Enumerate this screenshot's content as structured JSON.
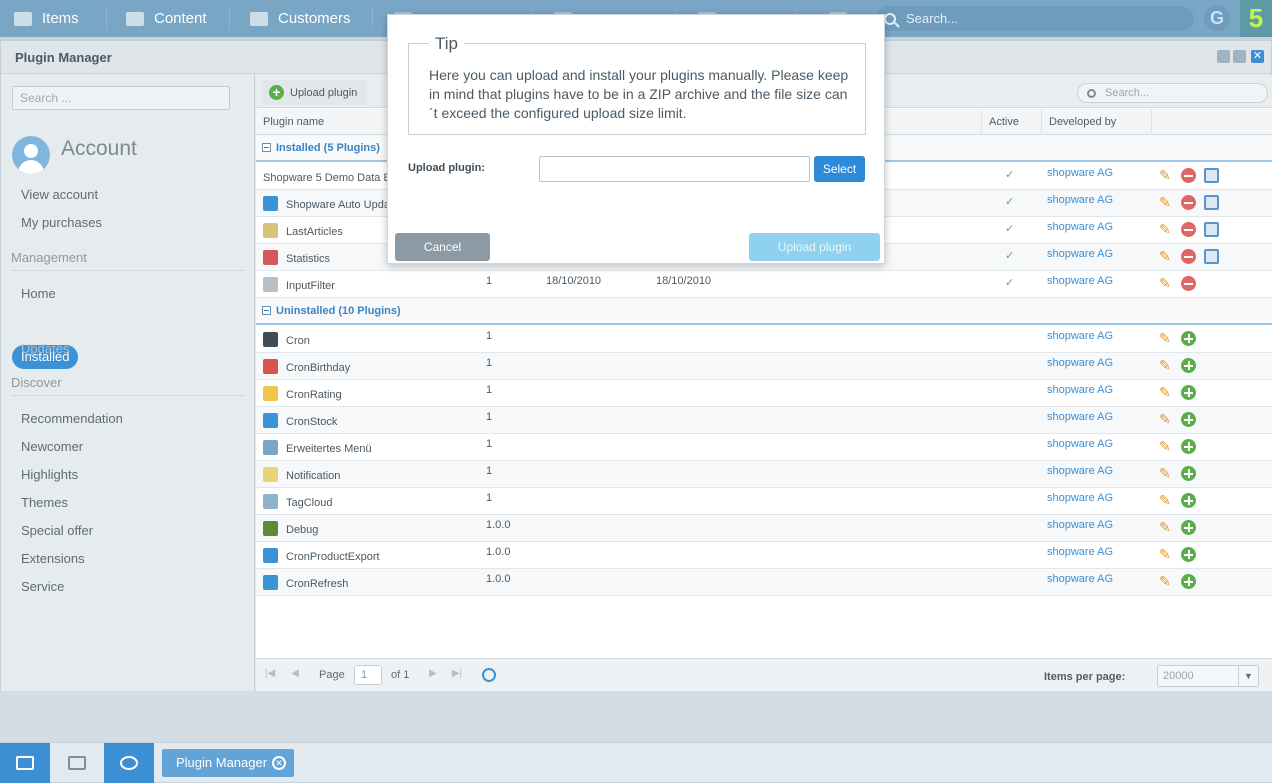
{
  "topbar": {
    "menu": [
      {
        "label": "Items",
        "icon": "items-icon"
      },
      {
        "label": "Content",
        "icon": "content-icon"
      },
      {
        "label": "Customers",
        "icon": "customers-icon"
      }
    ],
    "search_placeholder": "Search...",
    "brand_accent": "#c8f34a"
  },
  "window": {
    "title": "Plugin Manager"
  },
  "sidebar": {
    "search_placeholder": "Search ...",
    "account_title": "Account",
    "account_links": [
      "View account",
      "My purchases"
    ],
    "management_heading": "Management",
    "management_links": [
      "Home",
      "Installed",
      "Updates"
    ],
    "discover_heading": "Discover",
    "discover_links": [
      "Recommendation",
      "Newcomer",
      "Highlights",
      "Themes",
      "Special offer",
      "Extensions",
      "Service"
    ]
  },
  "toolbar": {
    "upload_label": "Upload plugin",
    "search_placeholder": "Search..."
  },
  "grid": {
    "columns": {
      "name": "Plugin name",
      "active": "Active",
      "developer": "Developed by"
    },
    "installed_group": "Installed (5 Plugins)",
    "uninstalled_group": "Uninstalled (10 Plugins)",
    "installed_rows": [
      {
        "name": "Shopware 5 Demo Data E",
        "version": "",
        "added": "",
        "updated": "",
        "active": "✓",
        "developer": "shopware AG",
        "icon": "demo-data-icon"
      },
      {
        "name": "Shopware Auto Upda",
        "version": "",
        "added": "",
        "updated": "",
        "active": "✓",
        "developer": "shopware AG",
        "icon": "auto-update-icon"
      },
      {
        "name": "LastArticles",
        "version": "",
        "added": "",
        "updated": "",
        "active": "✓",
        "developer": "shopware AG",
        "icon": "last-articles-icon"
      },
      {
        "name": "Statistics",
        "version": "",
        "added": "",
        "updated": "",
        "active": "✓",
        "developer": "shopware AG",
        "icon": "statistics-icon"
      },
      {
        "name": "InputFilter",
        "version": "1",
        "added": "18/10/2010",
        "updated": "18/10/2010",
        "active": "✓",
        "developer": "shopware AG",
        "icon": "input-filter-icon"
      }
    ],
    "uninstalled_rows": [
      {
        "name": "Cron",
        "version": "1",
        "developer": "shopware AG",
        "icon": "terminal-icon"
      },
      {
        "name": "CronBirthday",
        "version": "1",
        "developer": "shopware AG",
        "icon": "gift-icon"
      },
      {
        "name": "CronRating",
        "version": "1",
        "developer": "shopware AG",
        "icon": "star-icon"
      },
      {
        "name": "CronStock",
        "version": "1",
        "developer": "shopware AG",
        "icon": "chart-line-icon"
      },
      {
        "name": "Erweitertes Menü",
        "version": "1",
        "developer": "shopware AG",
        "icon": "menu-icon"
      },
      {
        "name": "Notification",
        "version": "1",
        "developer": "shopware AG",
        "icon": "notification-icon"
      },
      {
        "name": "TagCloud",
        "version": "1",
        "developer": "shopware AG",
        "icon": "tag-cloud-icon"
      },
      {
        "name": "Debug",
        "version": "1.0.0",
        "developer": "shopware AG",
        "icon": "bug-icon"
      },
      {
        "name": "CronProductExport",
        "version": "1.0.0",
        "developer": "shopware AG",
        "icon": "export-icon"
      },
      {
        "name": "CronRefresh",
        "version": "1.0.0",
        "developer": "shopware AG",
        "icon": "clock-icon"
      }
    ]
  },
  "pager": {
    "page_label": "Page",
    "page_value": "1",
    "of_label": "of 1",
    "items_per_page_label": "Items per page:",
    "items_per_page_value": "20000"
  },
  "taskbar": {
    "open_window": "Plugin Manager"
  },
  "modal": {
    "legend": "Tip",
    "text": "Here you can upload and install your plugins manually. Please keep in mind that plugins have to be in a ZIP archive and the file size can´t exceed the configured upload size limit.",
    "field_label": "Upload plugin:",
    "select_label": "Select",
    "cancel_label": "Cancel",
    "upload_label": "Upload plugin"
  },
  "colors": {
    "topbar": "#7aa6c6",
    "primary": "#3a93d6",
    "link": "#3a8fd6",
    "add_green": "#5cae4a",
    "remove_red": "#e06666"
  }
}
